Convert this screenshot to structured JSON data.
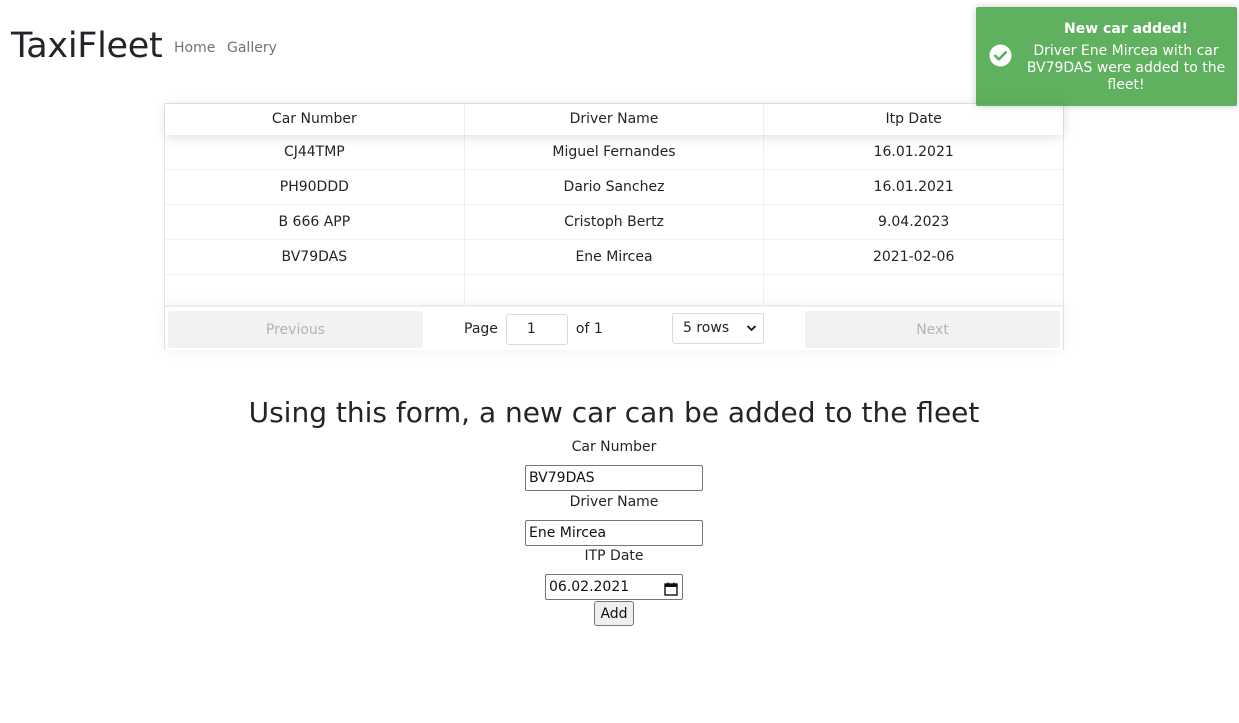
{
  "navbar": {
    "brand": "TaxiFleet",
    "links": [
      "Home",
      "Gallery"
    ]
  },
  "table": {
    "columns": [
      "Car Number",
      "Driver Name",
      "Itp Date"
    ],
    "rows": [
      [
        "CJ44TMP",
        "Miguel Fernandes",
        "16.01.2021"
      ],
      [
        "PH90DDD",
        "Dario Sanchez",
        "16.01.2021"
      ],
      [
        "B 666 APP",
        "Cristoph Bertz",
        "9.04.2023"
      ],
      [
        "BV79DAS",
        "Ene Mircea",
        "2021-02-06"
      ]
    ],
    "pagination": {
      "previous_label": "Previous",
      "next_label": "Next",
      "page_label": "Page",
      "page_value": "1",
      "of_label": "of 1",
      "rows_option": "5 rows"
    }
  },
  "form": {
    "title": "Using this form, a new car can be added to the fleet",
    "car_number_label": "Car Number",
    "car_number_value": "BV79DAS",
    "driver_name_label": "Driver Name",
    "driver_name_value": "Ene Mircea",
    "itp_date_label": "ITP Date",
    "itp_date_value": "06.02.2021",
    "add_label": "Add"
  },
  "toast": {
    "title": "New car added!",
    "message": "Driver Ene Mircea with car BV79DAS were added to the fleet!",
    "color": "#5fb05f",
    "icon": "check-circle-icon"
  }
}
